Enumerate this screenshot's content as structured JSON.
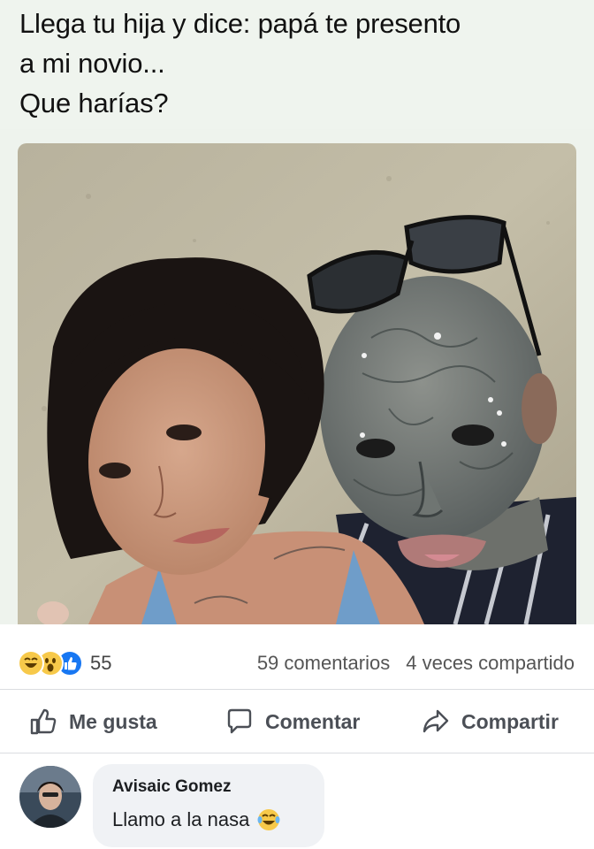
{
  "post": {
    "caption_lines": [
      "Llega tu hija y dice: papá te presento",
      "a mi novio...",
      "Que harías?"
    ]
  },
  "stats": {
    "reactions": [
      "haha-reaction",
      "wow-reaction",
      "like-reaction"
    ],
    "reaction_count": "55",
    "comments": "59 comentarios",
    "shares": "4 veces compartido"
  },
  "actions": {
    "like": "Me gusta",
    "comment": "Comentar",
    "share": "Compartir"
  },
  "comment": {
    "author": "Avisaic Gomez",
    "text": "Llamo a la nasa",
    "emoji": "tears-of-joy-emoji"
  },
  "colors": {
    "caption_bg": "#eff4ee",
    "facebook_blue": "#1877f2",
    "action_gray": "#4b4f56",
    "bubble_bg": "#f0f2f5"
  }
}
